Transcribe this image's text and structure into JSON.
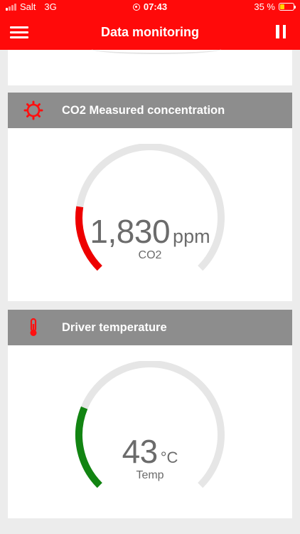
{
  "status_bar": {
    "carrier": "Salt",
    "network": "3G",
    "time": "07:43",
    "battery": "35 %",
    "battery_level": 0.35,
    "icons": [
      "signal-icon",
      "location-icon",
      "battery-icon"
    ]
  },
  "header": {
    "title": "Data monitoring",
    "menu_icon": "hamburger-menu-icon",
    "pause_icon": "pause-icon"
  },
  "colors": {
    "brand": "#ff0a0a",
    "card_header": "#8d8d8d",
    "co2_arc": "#ee0000",
    "temp_arc": "#128412",
    "track": "#e6e6e6"
  },
  "cards": [
    {
      "title": "CO2 Measured concentration",
      "icon": "gear-icon",
      "value": "1,830",
      "unit": "ppm",
      "label": "CO2",
      "level": 0.2
    },
    {
      "title": "Driver temperature",
      "icon": "thermometer-icon",
      "value": "43",
      "unit": "°C",
      "label": "Temp",
      "level": 0.25
    }
  ]
}
